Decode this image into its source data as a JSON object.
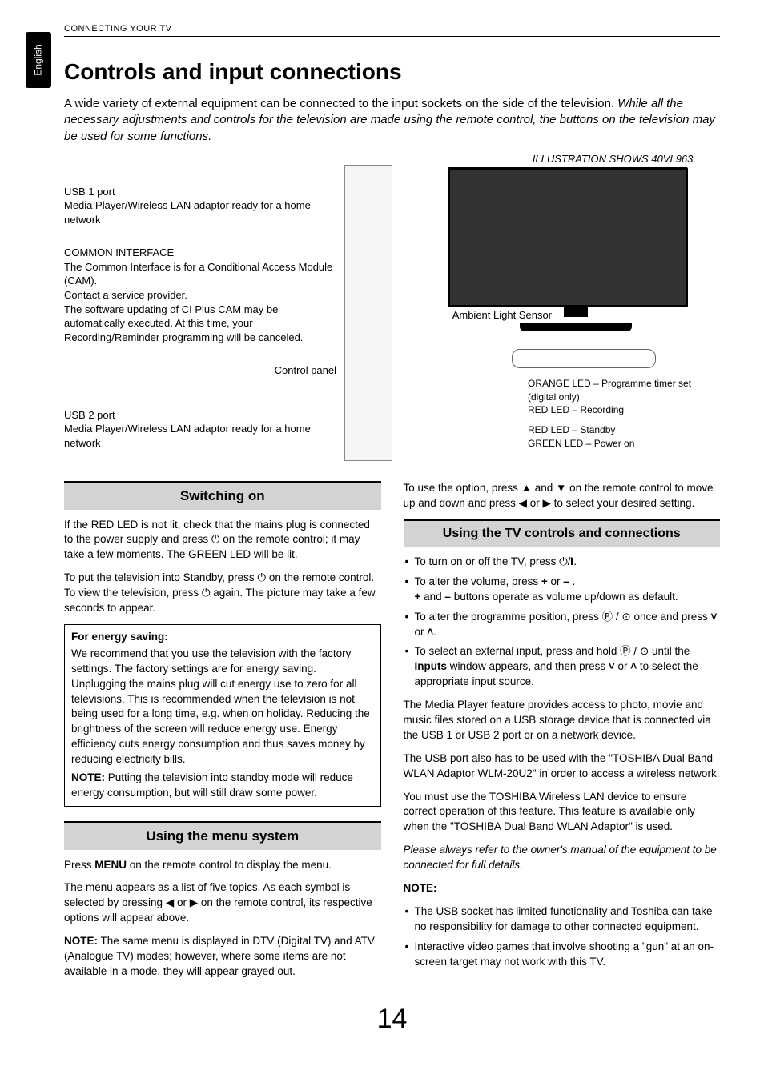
{
  "header": "CONNECTING YOUR TV",
  "lang_tab": "English",
  "title": "Controls and input connections",
  "intro_plain": "A wide variety of external equipment can be connected to the input sockets on the side of the television.",
  "intro_italic": "While all the necessary adjustments and controls for the television are made using the remote control, the buttons on the television may be used for some functions.",
  "illus_caption": "ILLUSTRATION SHOWS  40VL963.",
  "diagram": {
    "usb1_title": "USB 1 port",
    "usb1_desc": "Media Player/Wireless LAN adaptor ready for a home network",
    "common_title": "COMMON INTERFACE",
    "common_desc": "The Common Interface is for a Conditional Access Module (CAM).\nContact a service provider.\nThe software updating of CI Plus CAM may be automatically executed. At this time, your Recording/Reminder programming will be canceled.",
    "control_panel": "Control panel",
    "usb2_title": "USB 2 port",
    "usb2_desc": "Media Player/Wireless LAN adaptor ready for a home network",
    "sensor": "Ambient Light Sensor",
    "led1": "ORANGE LED – Programme timer set (digital only)",
    "led2": "RED LED – Recording",
    "led3": "RED LED – Standby",
    "led4": "GREEN LED – Power on"
  },
  "switching": {
    "heading": "Switching on",
    "p1a": "If the RED LED is not lit, check that the mains plug is connected to the power supply and press ",
    "p1b": " on the remote control; it may take a few moments. The GREEN LED will be lit.",
    "p2a": "To put the television into Standby, press ",
    "p2b": " on the remote control. To view the television, press ",
    "p2c": " again. The picture may take a few seconds to appear.",
    "energy_title": "For energy saving:",
    "energy_body": "We recommend that you use the television with the factory settings. The factory settings are for energy saving. Unplugging the mains plug will cut energy use to zero for all televisions. This is recommended when the television is not being used for a long time, e.g. when on holiday. Reducing the brightness of the screen will reduce energy use. Energy efficiency cuts energy consumption and thus saves money by reducing electricity bills.",
    "energy_note_label": "NOTE:",
    "energy_note": " Putting the television into standby mode will reduce energy consumption, but will still draw some power."
  },
  "menu": {
    "heading": "Using the menu system",
    "p1a": "Press ",
    "p1_menu": "MENU",
    "p1b": " on the remote control to display the menu.",
    "p2a": "The menu appears as a list of five topics. As each symbol is selected by pressing ",
    "p2b": " on the remote control, its respective options will appear above.",
    "p3_label": "NOTE:",
    "p3": " The same menu is displayed in DTV (Digital TV) and ATV (Analogue TV) modes; however, where some items are not available in a mode, they will appear grayed out."
  },
  "right_top": {
    "p1a": "To use the option, press ",
    "p1b": " on the remote control to move up and down and press ",
    "p1c": " to select your desired setting."
  },
  "controls": {
    "heading": "Using the TV controls and connections",
    "b1a": "To turn on or off the TV, press ",
    "b1b": ".",
    "b2a": "To alter the volume, press ",
    "b2_plus": "+",
    "b2_or": " or ",
    "b2_minus": "–",
    "b2b": " .",
    "b2c_plus": "+",
    "b2c_and": " and ",
    "b2c_minus": "–",
    "b2c_rest": " buttons operate as volume up/down as default.",
    "b3a": "To alter the programme position, press ",
    "b3b": " once and press ",
    "b3c": ".",
    "b4a": "To select an external input, press and hold ",
    "b4b": " until the ",
    "b4_inputs": "Inputs",
    "b4c": " window appears, and then press ",
    "b4d": " to select the appropriate input source.",
    "p1": "The Media Player feature provides access to photo, movie and music files stored on a USB storage device that is connected via the USB 1 or USB 2 port or on a network device.",
    "p2": "The USB port also has to be used with the \"TOSHIBA Dual Band WLAN Adaptor WLM-20U2\" in order to access a wireless network.",
    "p3": "You must use the TOSHIBA Wireless LAN device to ensure correct operation of this feature. This feature is available only when the \"TOSHIBA Dual Band WLAN Adaptor\" is used.",
    "p4": "Please always refer to the owner's manual of the equipment to be connected for full details.",
    "note_label": "NOTE:",
    "note1": "The USB socket has limited functionality and Toshiba can take no responsibility for damage to other connected equipment.",
    "note2": "Interactive video games that involve shooting a \"gun\" at an on-screen target may not work with this TV."
  },
  "page_number": "14",
  "icons": {
    "power": "⏻",
    "left": "◀",
    "right": "▶",
    "up": "▲",
    "down": "▼",
    "up_small": "˄",
    "down_small": "˅",
    "p_box": "Ⓟ",
    "input": "⊙",
    "powerbar": "⏻/❙"
  }
}
